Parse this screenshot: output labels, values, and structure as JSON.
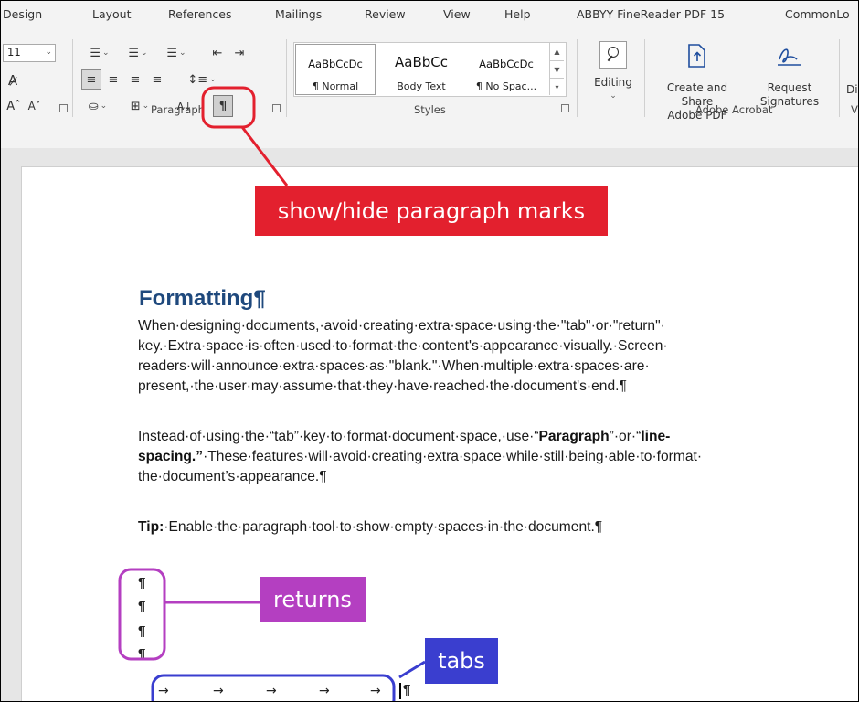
{
  "tabs": [
    "Design",
    "Layout",
    "References",
    "Mailings",
    "Review",
    "View",
    "Help",
    "ABBYY FineReader PDF 15",
    "CommonLo"
  ],
  "font": {
    "size": "11"
  },
  "ribbon": {
    "paragraph_group_label": "Paragraph",
    "styles_group_label": "Styles",
    "acrobat_group_label": "Adobe Acrobat",
    "clipped_right_label": "V",
    "clipped_right_button": "Di",
    "show_hide_glyph": "¶"
  },
  "styles": [
    {
      "preview": "AaBbCcDc",
      "name": "¶ Normal"
    },
    {
      "preview": "AaBbCc",
      "name": "Body Text"
    },
    {
      "preview": "AaBbCcDc",
      "name": "¶ No Spac..."
    }
  ],
  "editing": {
    "label": "Editing"
  },
  "acrobat": {
    "create_label_1": "Create and Share",
    "create_label_2": "Adobe PDF",
    "request_label_1": "Request",
    "request_label_2": "Signatures"
  },
  "document": {
    "heading": "Formatting¶",
    "p1_lines": [
      "When·designing·documents,·avoid·creating·extra·space·using·the·\"tab\"·or·\"return\"·",
      "key.·Extra·space·is·often·used·to·format·the·content's·appearance·visually.·Screen·",
      "readers·will·announce·extra·spaces·as·\"blank.\"·When·multiple·extra·spaces·are·",
      "present,·the·user·may·assume·that·they·have·reached·the·document's·end.¶"
    ],
    "p2_line1_a": "Instead·of·using·the·“tab”·key·to·format·document·space,·use·“",
    "p2_line1_b": "Paragraph",
    "p2_line1_c": "”·or·“",
    "p2_line1_d": "line-",
    "p2_line2_a": "spacing.”",
    "p2_line2_b": "·These·features·will·avoid·creating·extra·space·while·still·being·able·to·format·",
    "p2_line3": "the·document’s·appearance.¶",
    "tip_label": "Tip:",
    "tip_text": "·Enable·the·paragraph·tool·to·show·empty·spaces·in·the·document.¶",
    "pilcrow": "¶",
    "tab_arrow": "→"
  },
  "callouts": {
    "show_hide": "show/hide paragraph marks",
    "returns": "returns",
    "tabs": "tabs"
  },
  "colors": {
    "red_callout": "#e3202e",
    "purple_callout": "#b43fc1",
    "blue_callout": "#3a3ecf",
    "heading_blue": "#1f497d"
  }
}
